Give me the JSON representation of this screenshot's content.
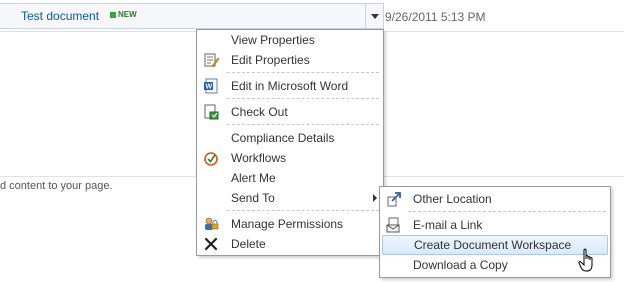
{
  "list_row": {
    "document_name": "Test document",
    "new_badge": "NEW",
    "modified": "9/26/2011 5:13 PM"
  },
  "page_text": "d content to your page.",
  "context_menu": {
    "items": [
      {
        "label": "View Properties",
        "icon": "none"
      },
      {
        "label": "Edit Properties",
        "icon": "edit-properties-icon"
      },
      {
        "label": "Edit in Microsoft Word",
        "icon": "word-icon"
      },
      {
        "label": "Check Out",
        "icon": "check-out-icon"
      },
      {
        "label": "Compliance Details",
        "icon": "none"
      },
      {
        "label": "Workflows",
        "icon": "workflows-icon"
      },
      {
        "label": "Alert Me",
        "icon": "none"
      },
      {
        "label": "Send To",
        "icon": "none"
      },
      {
        "label": "Manage Permissions",
        "icon": "permissions-icon"
      },
      {
        "label": "Delete",
        "icon": "delete-icon"
      }
    ]
  },
  "send_to_submenu": {
    "items": [
      {
        "label": "Other Location",
        "icon": "send-other-location-icon"
      },
      {
        "label": "E-mail a Link",
        "icon": "email-link-icon"
      },
      {
        "label": "Create Document Workspace",
        "icon": "none"
      },
      {
        "label": "Download a Copy",
        "icon": "none"
      }
    ],
    "highlighted": "Create Document Workspace"
  },
  "colors": {
    "link": "#0b5aa2",
    "menu_border": "#9a9a9a",
    "highlight": "#d9e9fb"
  }
}
